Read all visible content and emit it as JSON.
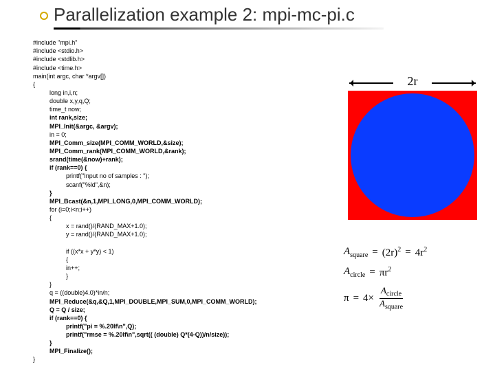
{
  "title": "Parallelization example 2: mpi-mc-pi.c",
  "code": {
    "l0": "#include \"mpi.h\"",
    "l1": "#include <stdio.h>",
    "l2": "#include <stdlib.h>",
    "l3": "#include <time.h>",
    "l4": "main(int argc, char *argv[])",
    "l5": "{",
    "l6": "long in,i,n;",
    "l7": "double x,y,q,Q;",
    "l8": "time_t now;",
    "l9": "int rank,size;",
    "l10": "MPI_Init(&argc, &argv);",
    "l11": "in = 0;",
    "l12": "MPI_Comm_size(MPI_COMM_WORLD,&size);",
    "l13": "MPI_Comm_rank(MPI_COMM_WORLD,&rank);",
    "l14": "srand(time(&now)+rank);",
    "l15": "if (rank==0) {",
    "l16": "printf(\"Input no of samples : \");",
    "l17": "scanf(\"%ld\",&n);",
    "l18": "}",
    "l19": "MPI_Bcast(&n,1,MPI_LONG,0,MPI_COMM_WORLD);",
    "l20": "for (i=0;i<n;i++)",
    "l21": "{",
    "l22": "x = rand()/(RAND_MAX+1.0);",
    "l23": "y = rand()/(RAND_MAX+1.0);",
    "l24": "if ((x*x + y*y) < 1)",
    "l25": "{",
    "l26": "in++;",
    "l27": "}",
    "l28": "}",
    "l29": "q = ((double)4.0)*in/n;",
    "l30": "MPI_Reduce(&q,&Q,1,MPI_DOUBLE,MPI_SUM,0,MPI_COMM_WORLD);",
    "l31": "Q = Q / size;",
    "l32": "if (rank==0) {",
    "l33": "printf(\"pi = %.20lf\\n\",Q);",
    "l34": "printf(\"rmse = %.20lf\\n\",sqrt(( (double) Q*(4-Q))/n/size));",
    "l35": "}",
    "l36": "MPI_Finalize();",
    "l37": "}"
  },
  "figure": {
    "radius_label": "2r"
  },
  "formulas": {
    "a_square_lhs": "A",
    "a_square_sub": "square",
    "eq": "=",
    "two_r_sq": "(2r)",
    "sq": "2",
    "four_r_sq": "4r",
    "a_circle_lhs": "A",
    "a_circle_sub": "circle",
    "pi_r_sq": "πr",
    "pi": "π",
    "four_times": "4×",
    "frac_top_A": "A",
    "frac_top_sub": "circle",
    "frac_bot_A": "A",
    "frac_bot_sub": "square"
  }
}
